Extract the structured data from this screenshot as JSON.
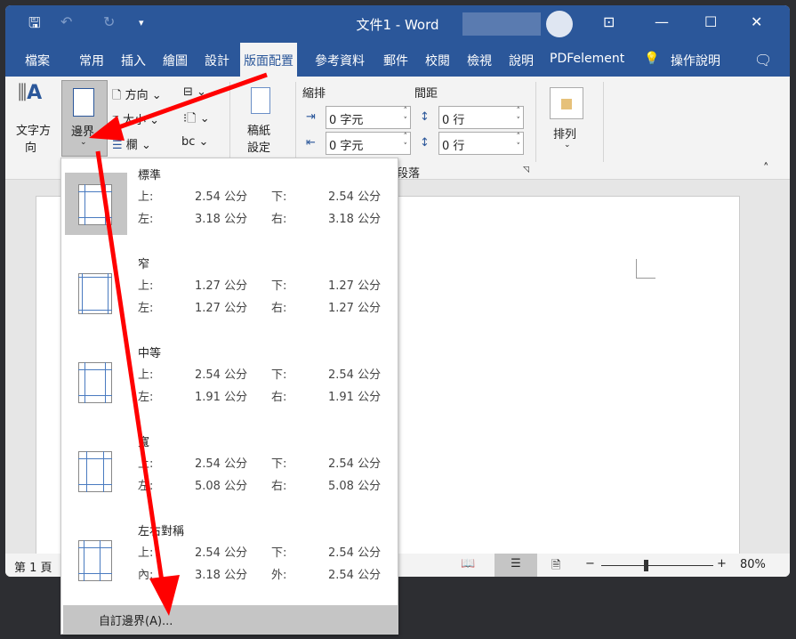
{
  "window": {
    "title": "文件1  -  Word"
  },
  "tabs": [
    "檔案",
    "常用",
    "插入",
    "繪圖",
    "設計",
    "版面配置",
    "參考資料",
    "郵件",
    "校閱",
    "檢視",
    "說明",
    "PDFelement",
    "操作說明"
  ],
  "active_tab": "版面配置",
  "ribbon": {
    "text_direction": "文字方\n向",
    "text_direction_1": "文字方",
    "text_direction_2": "向",
    "margins": "邊界",
    "orientation": "方向",
    "size": "大小",
    "columns": "欄",
    "manuscript_1": "稿紙",
    "manuscript_2": "設定",
    "indent": "縮排",
    "spacing": "間距",
    "indent_left": "0 字元",
    "indent_right": "0 字元",
    "spacing_before": "0 行",
    "spacing_after": "0 行",
    "paragraph_group": "段落",
    "arrange": "排列"
  },
  "margins_menu": {
    "items": [
      {
        "name": "標準",
        "l1": "上:",
        "v1": "2.54 公分",
        "l2": "下:",
        "v2": "2.54 公分",
        "l3": "左:",
        "v3": "3.18 公分",
        "l4": "右:",
        "v4": "3.18 公分",
        "selected": true
      },
      {
        "name": "窄",
        "l1": "上:",
        "v1": "1.27 公分",
        "l2": "下:",
        "v2": "1.27 公分",
        "l3": "左:",
        "v3": "1.27 公分",
        "l4": "右:",
        "v4": "1.27 公分"
      },
      {
        "name": "中等",
        "l1": "上:",
        "v1": "2.54 公分",
        "l2": "下:",
        "v2": "2.54 公分",
        "l3": "左:",
        "v3": "1.91 公分",
        "l4": "右:",
        "v4": "1.91 公分"
      },
      {
        "name": "寬",
        "l1": "上:",
        "v1": "2.54 公分",
        "l2": "下:",
        "v2": "2.54 公分",
        "l3": "左:",
        "v3": "5.08 公分",
        "l4": "右:",
        "v4": "5.08 公分"
      },
      {
        "name": "左右對稱",
        "l1": "上:",
        "v1": "2.54 公分",
        "l2": "下:",
        "v2": "2.54 公分",
        "l3": "內:",
        "v3": "3.18 公分",
        "l4": "外:",
        "v4": "2.54 公分"
      }
    ],
    "custom": "自訂邊界(A)..."
  },
  "status": {
    "page": "第 1 頁",
    "zoom": "80%"
  },
  "colors": {
    "accent": "#2b579a",
    "annotation_arrow": "#ff0000"
  }
}
